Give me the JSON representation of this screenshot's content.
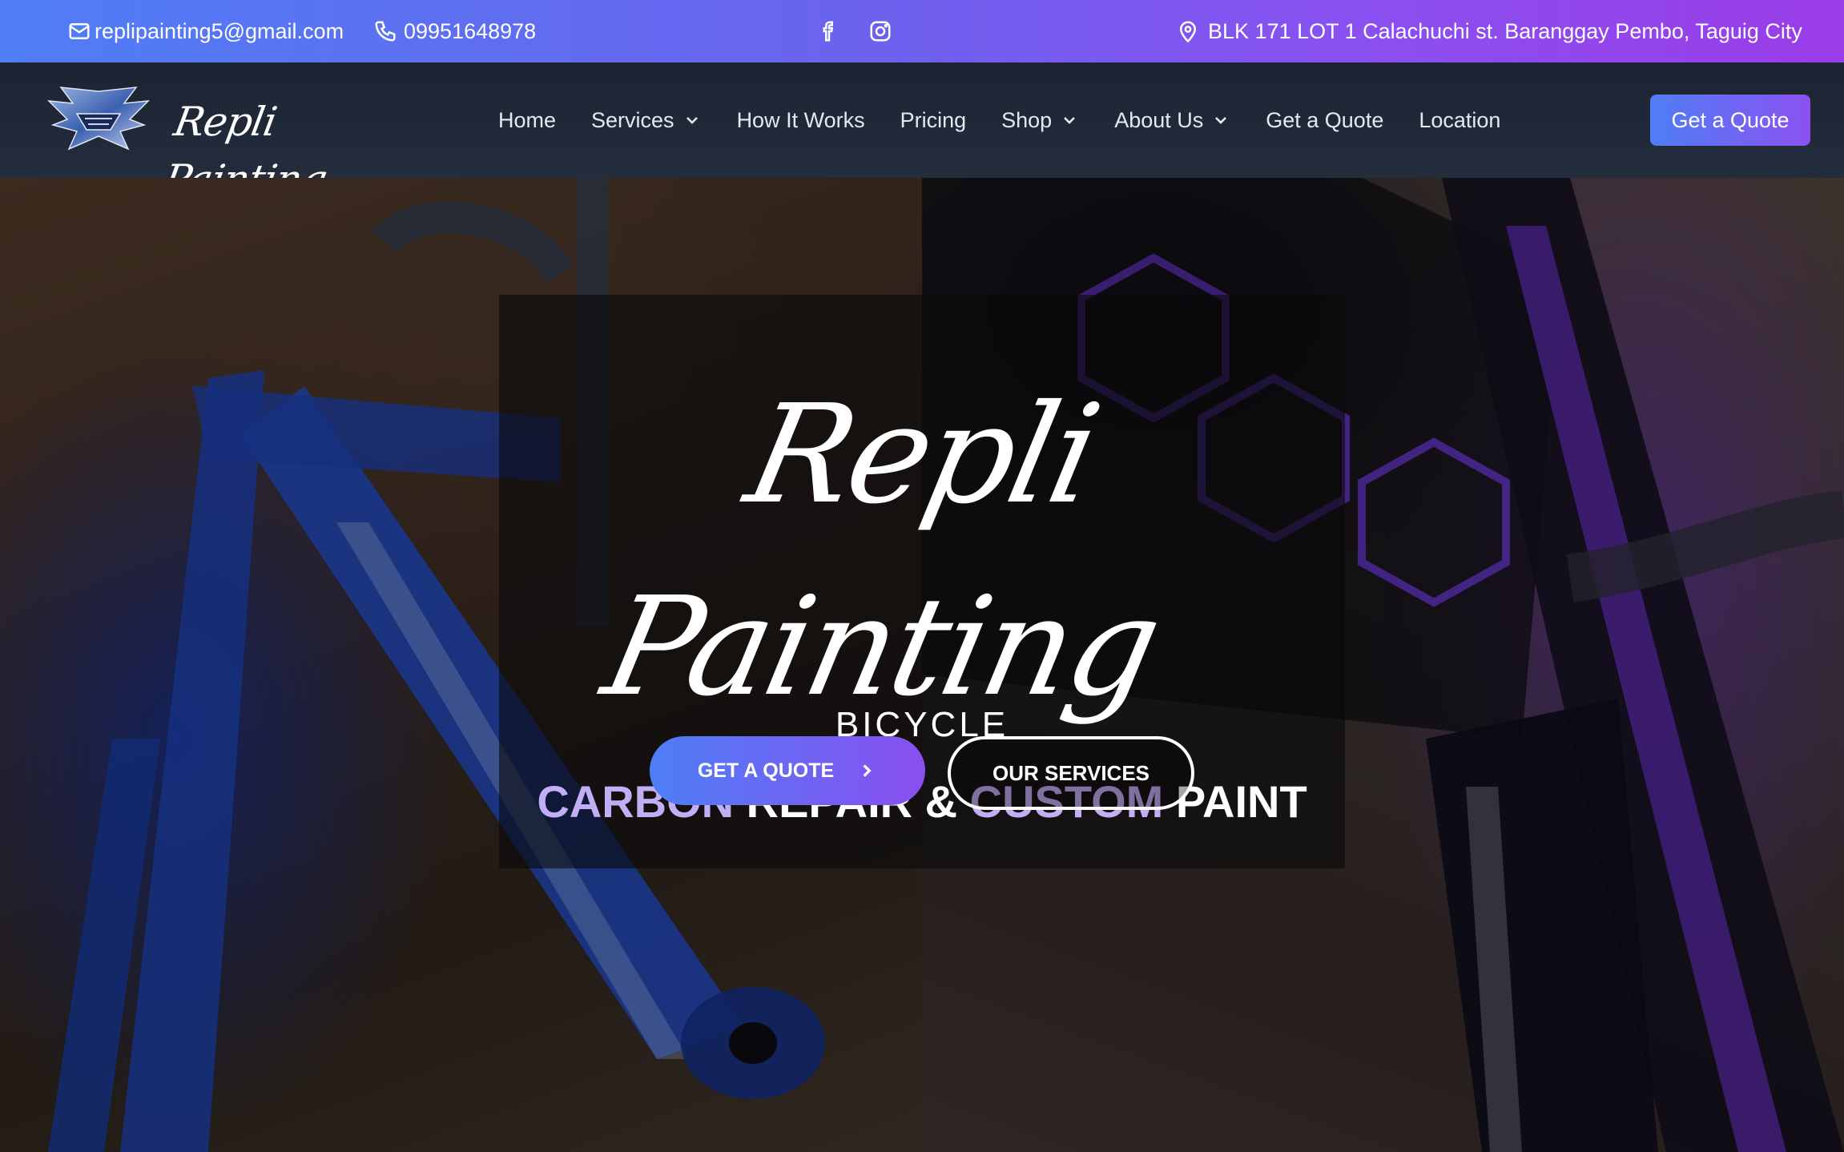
{
  "topbar": {
    "email": "replipainting5@gmail.com",
    "phone": "09951648978",
    "address": "BLK 171 LOT 1 Calachuchi st. Baranggay Pembo, Taguig City",
    "icons": [
      "mail-icon",
      "phone-icon",
      "facebook-icon",
      "instagram-icon",
      "map-pin-icon"
    ]
  },
  "brand": {
    "logo_text": "Repli Painting"
  },
  "nav": {
    "items": [
      {
        "label": "Home",
        "dropdown": false
      },
      {
        "label": "Services",
        "dropdown": true
      },
      {
        "label": "How It Works",
        "dropdown": false
      },
      {
        "label": "Pricing",
        "dropdown": false
      },
      {
        "label": "Shop",
        "dropdown": true
      },
      {
        "label": "About Us",
        "dropdown": true
      },
      {
        "label": "Get a Quote",
        "dropdown": false
      },
      {
        "label": "Location",
        "dropdown": false
      }
    ],
    "cta_label": "Get a Quote"
  },
  "hero": {
    "script_title": "Repli Painting",
    "subtitle": "BICYCLE",
    "title_parts": {
      "accent1": "CARBON",
      "plain1": "REPAIR &",
      "accent2": "CUSTOM",
      "plain2": "PAINT"
    },
    "primary_button": "GET A QUOTE",
    "secondary_button": "OUR SERVICES"
  },
  "colors": {
    "gradient_start": "#4f7ef6",
    "gradient_end": "#9a3ce8",
    "accent_text": "#c2aef5",
    "nav_bg": "#1c2433"
  }
}
